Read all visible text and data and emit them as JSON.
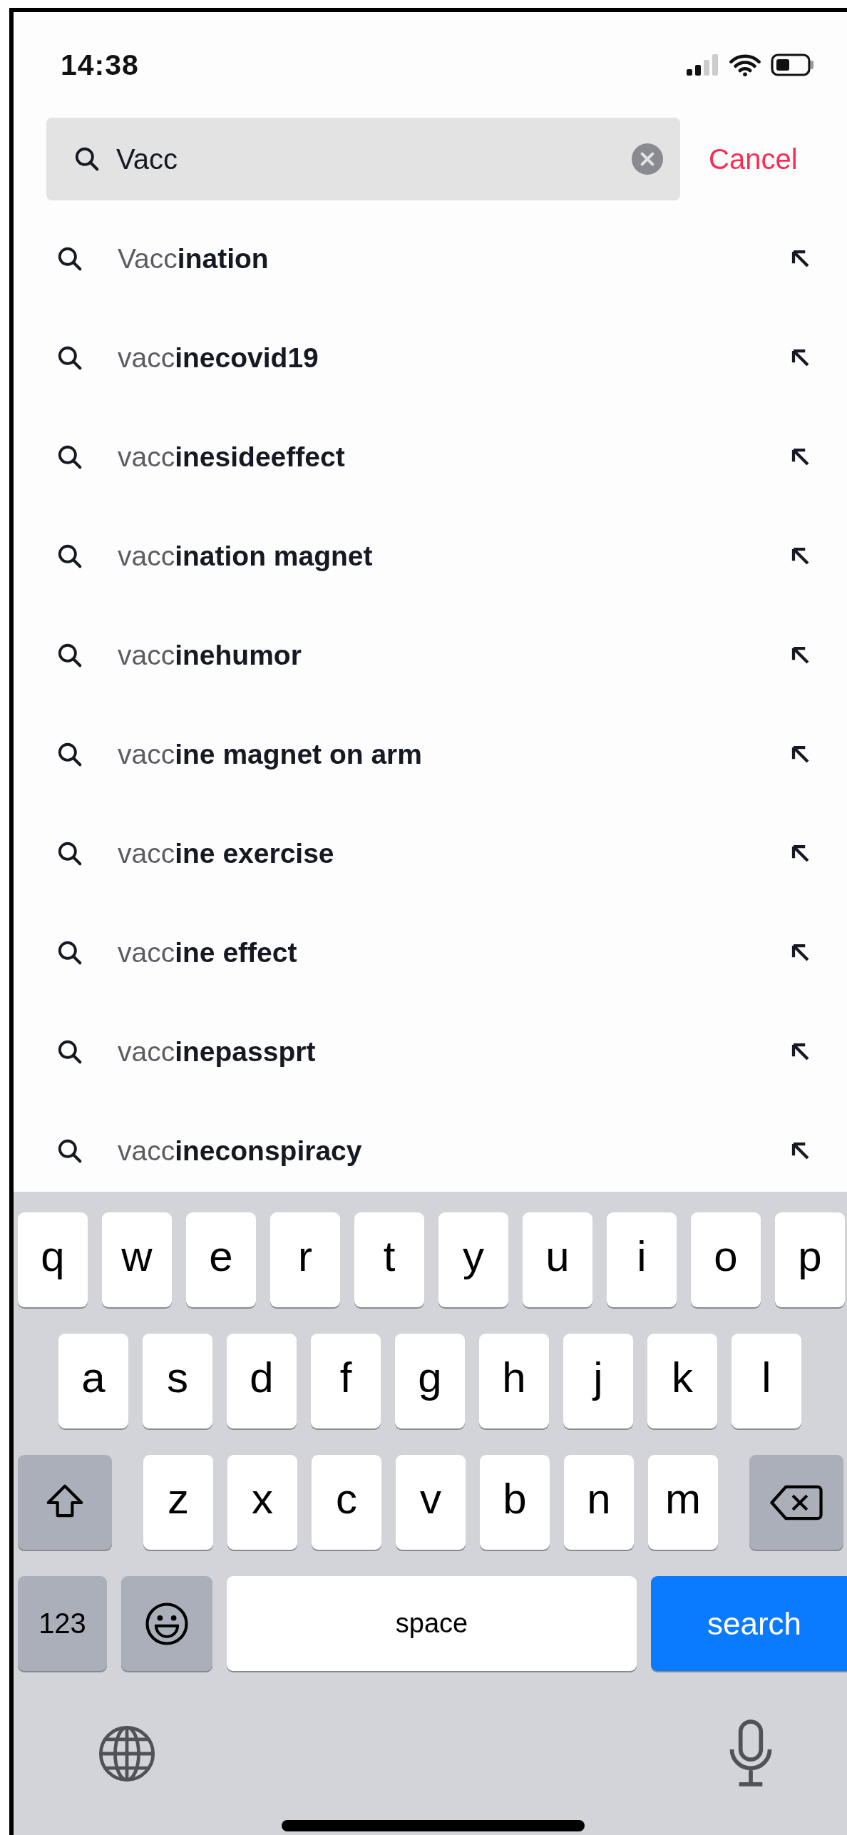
{
  "status_bar": {
    "time": "14:38"
  },
  "search": {
    "value": "Vacc",
    "cancel": "Cancel"
  },
  "suggestions": [
    {
      "text": "Vacc**ination**"
    },
    {
      "text": "vacc**inecovid19**"
    },
    {
      "text": "vacc**inesideeffect**"
    },
    {
      "text": "vacc**ination magnet**"
    },
    {
      "text": "vacc**inehumor**"
    },
    {
      "text": "vacc**ine magnet on arm**"
    },
    {
      "text": "vacc**ine exercise**"
    },
    {
      "text": "vacc**ine effect**"
    },
    {
      "text": "vacc**inepassprt**"
    },
    {
      "text": "vacc**ineconspiracy**"
    }
  ],
  "keyboard": {
    "rows": [
      {
        "keys": [
          {
            "kind": "letter",
            "label": "q"
          },
          {
            "kind": "letter",
            "label": "w"
          },
          {
            "kind": "letter",
            "label": "e"
          },
          {
            "kind": "letter",
            "label": "r"
          },
          {
            "kind": "letter",
            "label": "t"
          },
          {
            "kind": "letter",
            "label": "y"
          },
          {
            "kind": "letter",
            "label": "u"
          },
          {
            "kind": "letter",
            "label": "i"
          },
          {
            "kind": "letter",
            "label": "o"
          },
          {
            "kind": "letter",
            "label": "p"
          }
        ]
      },
      {
        "keys": [
          {
            "kind": "letter",
            "label": "a"
          },
          {
            "kind": "letter",
            "label": "s"
          },
          {
            "kind": "letter",
            "label": "d"
          },
          {
            "kind": "letter",
            "label": "f"
          },
          {
            "kind": "letter",
            "label": "g"
          },
          {
            "kind": "letter",
            "label": "h"
          },
          {
            "kind": "letter",
            "label": "j"
          },
          {
            "kind": "letter",
            "label": "k"
          },
          {
            "kind": "letter",
            "label": "l"
          }
        ]
      },
      {
        "keys": [
          {
            "kind": "shift"
          },
          {
            "kind": "letter",
            "label": "z"
          },
          {
            "kind": "letter",
            "label": "x"
          },
          {
            "kind": "letter",
            "label": "c"
          },
          {
            "kind": "letter",
            "label": "v"
          },
          {
            "kind": "letter",
            "label": "b"
          },
          {
            "kind": "letter",
            "label": "n"
          },
          {
            "kind": "letter",
            "label": "m"
          },
          {
            "kind": "delete"
          }
        ]
      },
      {
        "keys": [
          {
            "kind": "mode",
            "label": "123"
          },
          {
            "kind": "emoji"
          },
          {
            "kind": "space",
            "label": "space"
          },
          {
            "kind": "action",
            "label": "search"
          }
        ]
      }
    ],
    "bottom": [
      {
        "kind": "globe"
      },
      {
        "kind": "mic"
      }
    ]
  }
}
